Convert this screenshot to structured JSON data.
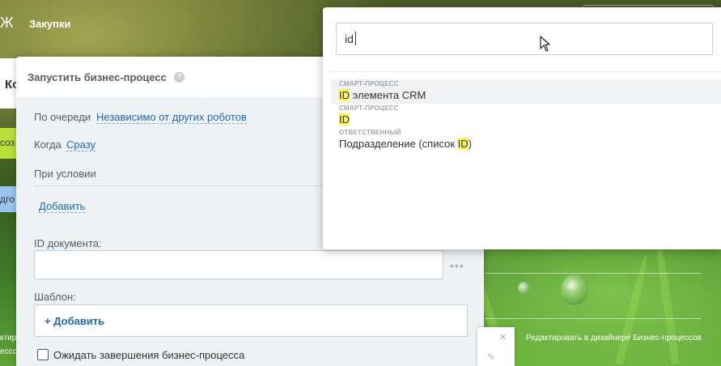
{
  "topbar": {
    "glyph": "Ж",
    "title": "Закупки"
  },
  "left_strip": {
    "fragment_ko": "Ко",
    "fragment_green": "соз",
    "fragment_blue": "дго",
    "fragment_text1": "ктир",
    "fragment_text2": "ессов"
  },
  "panel": {
    "title": "Запустить бизнес-процесс",
    "help_icon": "?",
    "order_label": "По очереди",
    "order_value": "Независимо от других роботов",
    "when_label": "Когда",
    "when_value": "Сразу",
    "condition_label": "При условии",
    "add_condition": "Добавить",
    "doc_id_label": "ID документа:",
    "doc_id_value": "",
    "dots": "•••",
    "template_label": "Шаблон:",
    "template_add": "+ Добавить",
    "wait_checkbox_label": "Ожидать завершения бизнес-процесса"
  },
  "search": {
    "query": "id",
    "results": [
      {
        "category": "смарт-процесс",
        "pre": "",
        "match": "ID",
        "post": " элемента CRM"
      },
      {
        "category": "смарт-процесс",
        "pre": "",
        "match": "ID",
        "post": ""
      },
      {
        "category": "ответственный",
        "pre": "Подразделение (список ",
        "match": "ID",
        "post": ")"
      }
    ]
  },
  "card": {
    "close": "✕",
    "pencil": "✎"
  },
  "designer_link": "Редактировать в дизайнере Бизнес-процессов"
}
